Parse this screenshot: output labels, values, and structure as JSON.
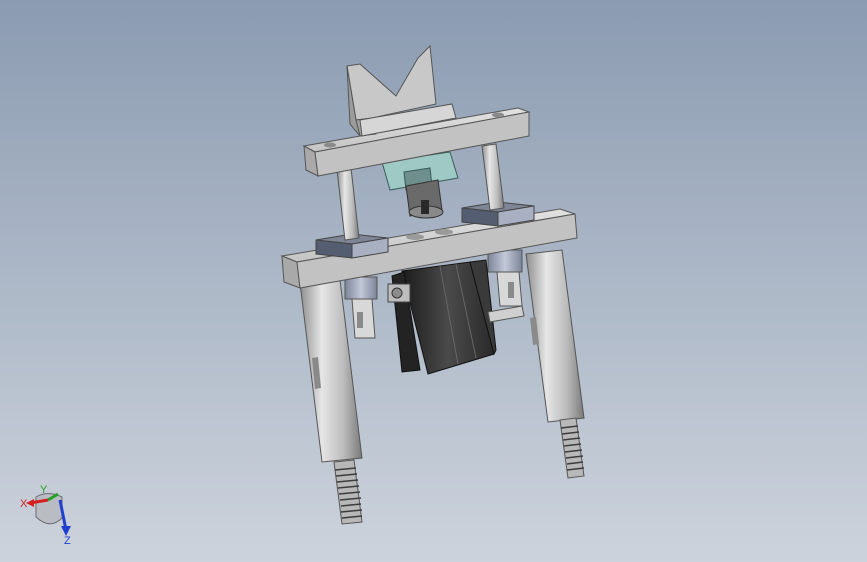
{
  "viewport": {
    "background_top": "#8b9bb1",
    "background_bottom": "#cdd3dc"
  },
  "model": {
    "parts": [
      "v-block",
      "top-plate",
      "upper-guide-rods",
      "guide-block",
      "lower-plate",
      "linear-bushings",
      "air-cylinder",
      "support-legs",
      "threaded-studs"
    ],
    "colors": {
      "steel": "#c9c9c9",
      "cylinder": "#2e2e2e",
      "guide_block": "#9ec9c4",
      "bushing": "#a7b0c4"
    }
  },
  "triad": {
    "x_label": "X",
    "y_label": "Y",
    "z_label": "Z",
    "x_color": "#d42020",
    "y_color": "#27a027",
    "z_color": "#1f3fcf"
  }
}
